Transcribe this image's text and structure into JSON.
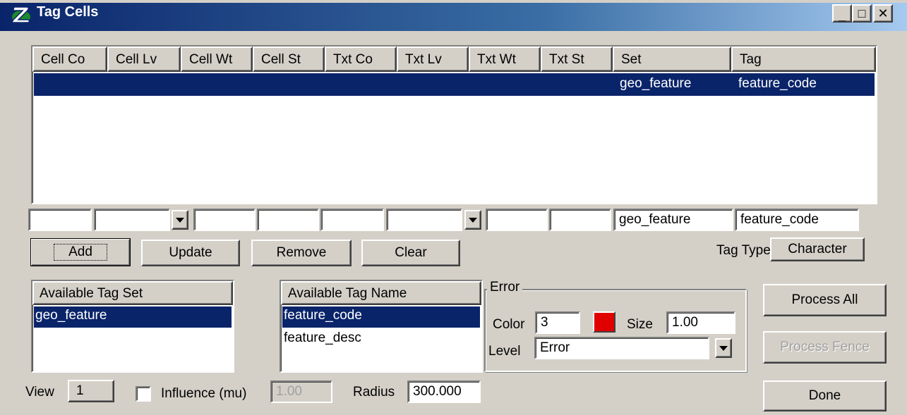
{
  "window": {
    "title": "Tag Cells",
    "minimize": "_",
    "maximize": "□",
    "close": "✕"
  },
  "table": {
    "columns": [
      "Cell Co",
      "Cell Lv",
      "Cell Wt",
      "Cell St",
      "Txt Co",
      "Txt Lv",
      "Txt Wt",
      "Txt St",
      "Set",
      "Tag"
    ],
    "rows": [
      {
        "set": "geo_feature",
        "tag": "feature_code"
      }
    ]
  },
  "edit_row": {
    "cell_co": "",
    "cell_lv": "",
    "cell_wt": "",
    "cell_st": "",
    "txt_co": "",
    "txt_lv": "",
    "txt_wt": "",
    "txt_st": "",
    "set": "geo_feature",
    "tag": "feature_code"
  },
  "buttons": {
    "add": "Add",
    "update": "Update",
    "remove": "Remove",
    "clear": "Clear",
    "process_all": "Process All",
    "process_fence": "Process Fence",
    "done": "Done"
  },
  "tag_type": {
    "label": "Tag Type",
    "value": "Character"
  },
  "tag_sets": {
    "header": "Available Tag Set",
    "items": [
      "geo_feature"
    ],
    "selected": "geo_feature"
  },
  "tag_names": {
    "header": "Available Tag Name",
    "items": [
      "feature_code",
      "feature_desc"
    ],
    "selected": "feature_code"
  },
  "error": {
    "group_title": "Error",
    "color_label": "Color",
    "color_value": "3",
    "swatch_color": "#e00000",
    "size_label": "Size",
    "size_value": "1.00",
    "level_label": "Level",
    "level_value": "Error"
  },
  "bottom": {
    "view_label": "View",
    "view_value": "1",
    "influence_label": "Influence (mu)",
    "influence_checked": false,
    "influence_value": "1.00",
    "radius_label": "Radius",
    "radius_value": "300.000"
  },
  "colors": {
    "selection": "#0a246a",
    "face": "#d4d0c8",
    "titlebar_start": "#0a246a"
  },
  "icons": [
    "app-logo-icon",
    "minimize-icon",
    "maximize-icon",
    "close-icon",
    "dropdown-arrow-icon"
  ]
}
